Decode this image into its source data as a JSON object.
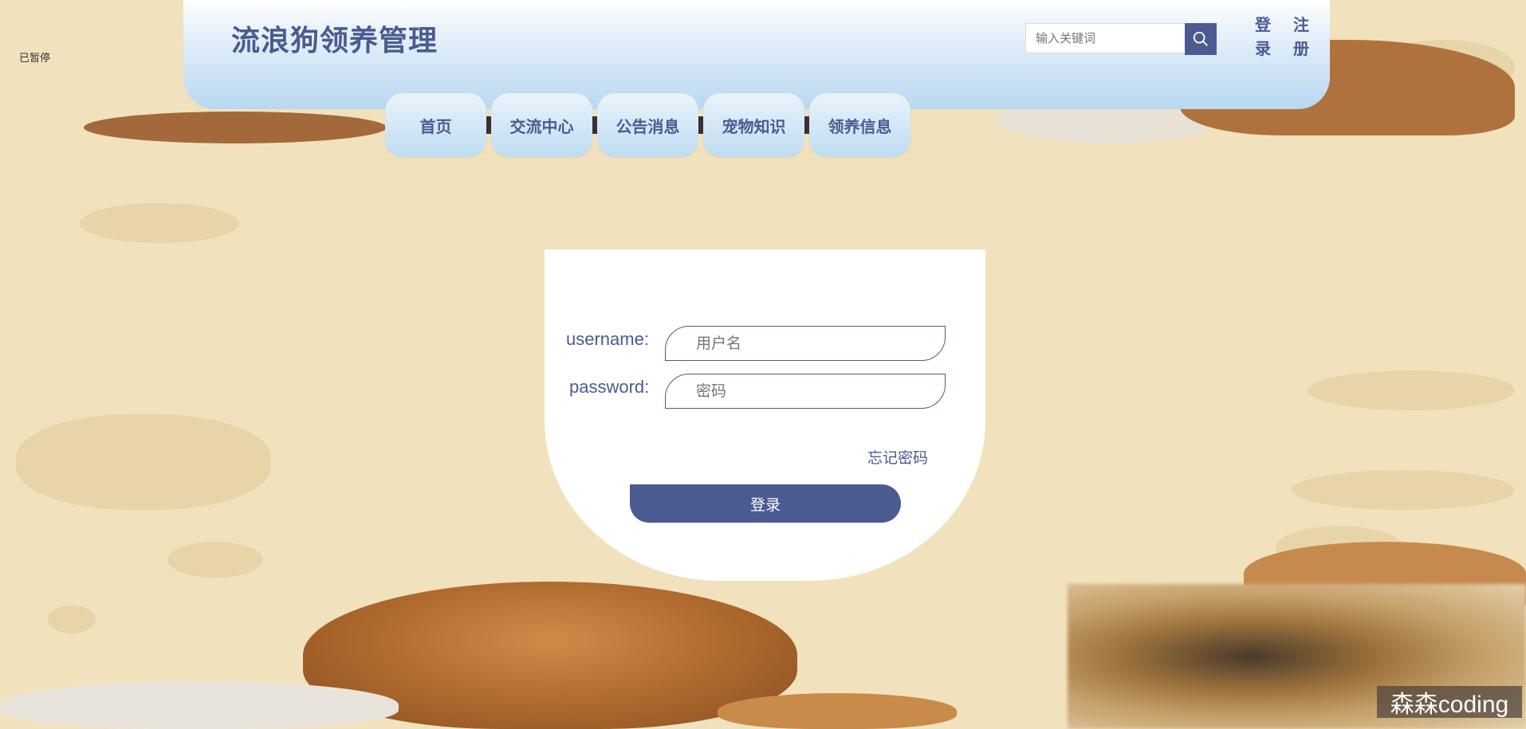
{
  "corner_label": "已暂停",
  "header": {
    "site_title": "流浪狗领养管理",
    "search": {
      "placeholder": "输入关键词",
      "value": ""
    },
    "login_link": "登录",
    "register_link": "注册"
  },
  "nav": {
    "tabs": [
      {
        "label": "首页"
      },
      {
        "label": "交流中心"
      },
      {
        "label": "公告消息"
      },
      {
        "label": "宠物知识"
      },
      {
        "label": "领养信息"
      }
    ]
  },
  "login_form": {
    "username_label": "username:",
    "username_placeholder": "用户名",
    "password_label": "password:",
    "password_placeholder": "密码",
    "forgot_password": "忘记密码",
    "submit_label": "登录"
  },
  "watermark": "森森coding",
  "colors": {
    "accent": "#4c5a92",
    "background": "#f1e2bd",
    "header_gradient_bottom": "#b9d8f1"
  },
  "icons": {
    "search_button": "search-icon"
  }
}
